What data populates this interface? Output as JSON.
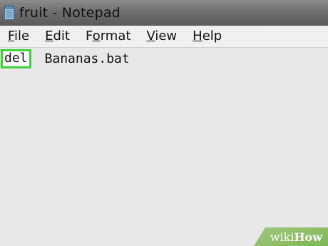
{
  "window": {
    "title": "fruit - Notepad",
    "app_icon": "notepad-icon"
  },
  "menu": {
    "items": [
      {
        "mnemonic": "F",
        "rest": "ile"
      },
      {
        "mnemonic": "E",
        "rest": "dit"
      },
      {
        "mnemonic": "",
        "prefix": "F",
        "underline": "o",
        "rest": "rmat"
      },
      {
        "mnemonic": "V",
        "rest": "iew"
      },
      {
        "mnemonic": "H",
        "rest": "elp"
      }
    ]
  },
  "editor": {
    "highlighted_word": "del",
    "rest_text": "Bananas.bat"
  },
  "watermark": {
    "part1": "wiki",
    "part2": "How"
  },
  "colors": {
    "highlight_border": "#3bd43b",
    "editor_background": "#e8e8e8",
    "watermark_green": "#8bbf63"
  }
}
